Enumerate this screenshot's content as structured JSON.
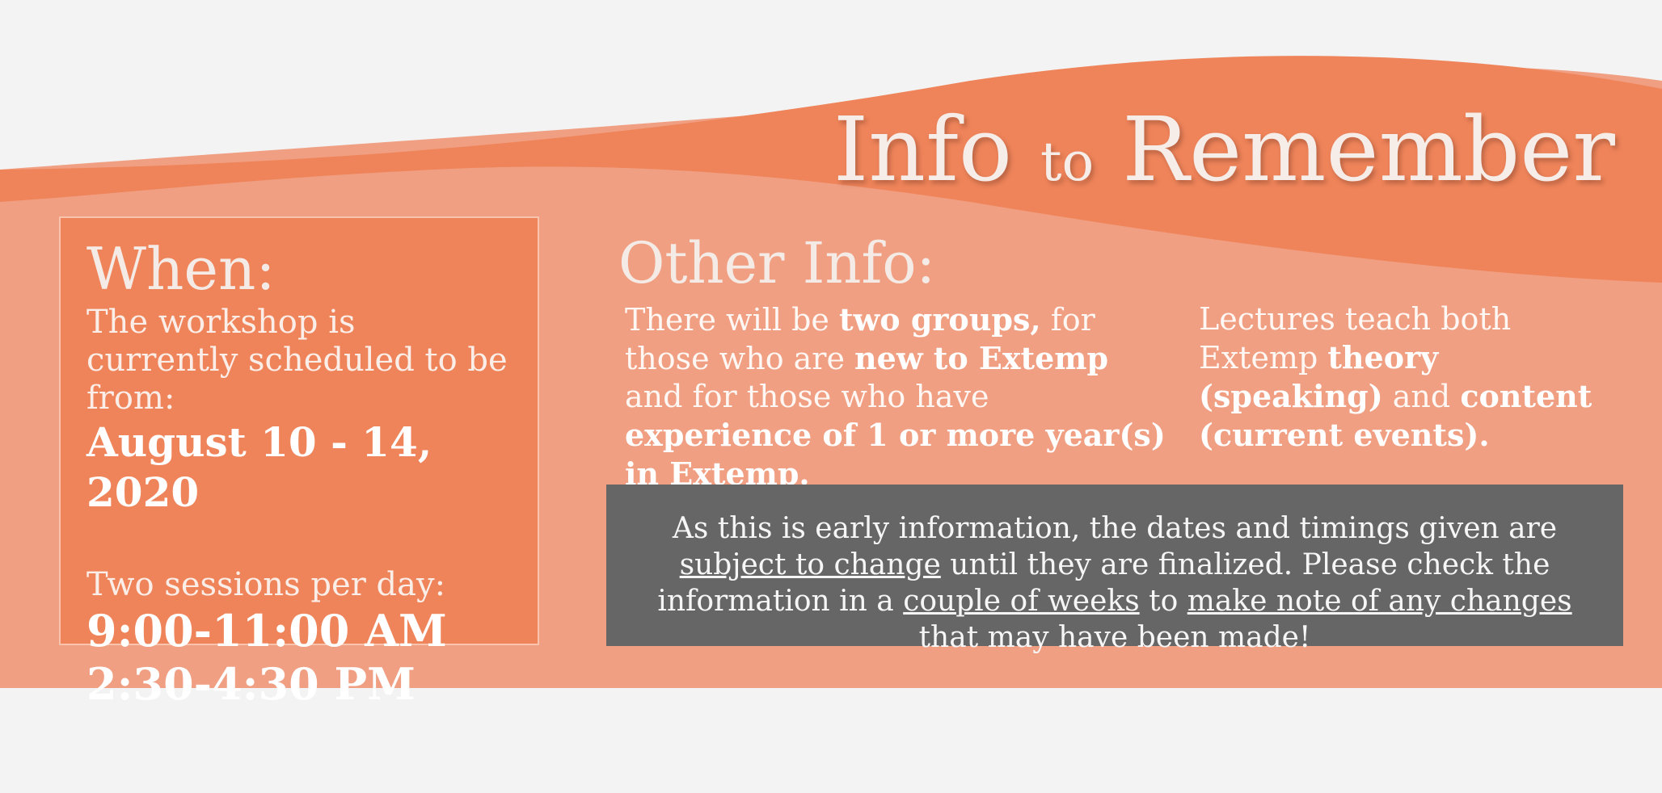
{
  "title": {
    "part1": "Info",
    "part2": "to",
    "part3": "Remember"
  },
  "when": {
    "heading": "When:",
    "intro": "The workshop is currently scheduled to be from:",
    "dates": "August 10 - 14, 2020",
    "sessions_label": "Two sessions per day:",
    "session1": "9:00-11:00 AM",
    "session2": "2:30-4:30 PM"
  },
  "other": {
    "heading": "Other Info:",
    "col1": {
      "t1": "There will be ",
      "b1": "two groups,",
      "t2": " for those who are ",
      "b2": "new to Extemp",
      "t3": " and for those who have ",
      "b3": "experience of 1 or more year(s) in Extemp."
    },
    "col2": {
      "t1": "Lectures teach both Extemp ",
      "b1": "theory (speaking)",
      "t2": " and ",
      "b2": "content (current events)."
    }
  },
  "note": {
    "t1": "As this is early information, the dates and timings given are ",
    "u1": "subject to change",
    "t2": " until they are finalized. Please check the information in a ",
    "u2": "couple of weeks",
    "t3": " to ",
    "u3": "make note of any changes",
    "t4": " that may have been made!"
  },
  "colors": {
    "background": "#f3f3f3",
    "light_orange": "#f09f82",
    "dark_orange": "#ef845a",
    "note_gray": "#666666"
  }
}
